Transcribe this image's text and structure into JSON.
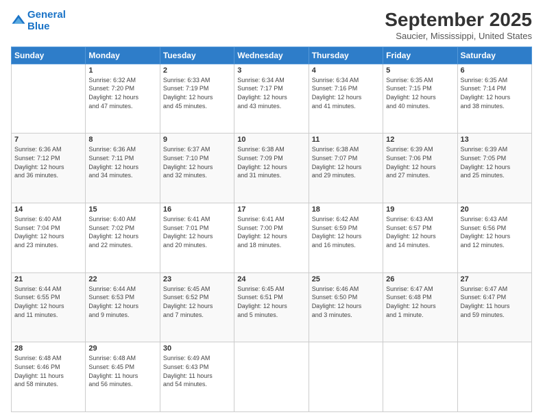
{
  "logo": {
    "line1": "General",
    "line2": "Blue"
  },
  "header": {
    "title": "September 2025",
    "subtitle": "Saucier, Mississippi, United States"
  },
  "weekdays": [
    "Sunday",
    "Monday",
    "Tuesday",
    "Wednesday",
    "Thursday",
    "Friday",
    "Saturday"
  ],
  "weeks": [
    [
      {
        "day": "",
        "info": ""
      },
      {
        "day": "1",
        "info": "Sunrise: 6:32 AM\nSunset: 7:20 PM\nDaylight: 12 hours\nand 47 minutes."
      },
      {
        "day": "2",
        "info": "Sunrise: 6:33 AM\nSunset: 7:19 PM\nDaylight: 12 hours\nand 45 minutes."
      },
      {
        "day": "3",
        "info": "Sunrise: 6:34 AM\nSunset: 7:17 PM\nDaylight: 12 hours\nand 43 minutes."
      },
      {
        "day": "4",
        "info": "Sunrise: 6:34 AM\nSunset: 7:16 PM\nDaylight: 12 hours\nand 41 minutes."
      },
      {
        "day": "5",
        "info": "Sunrise: 6:35 AM\nSunset: 7:15 PM\nDaylight: 12 hours\nand 40 minutes."
      },
      {
        "day": "6",
        "info": "Sunrise: 6:35 AM\nSunset: 7:14 PM\nDaylight: 12 hours\nand 38 minutes."
      }
    ],
    [
      {
        "day": "7",
        "info": "Sunrise: 6:36 AM\nSunset: 7:12 PM\nDaylight: 12 hours\nand 36 minutes."
      },
      {
        "day": "8",
        "info": "Sunrise: 6:36 AM\nSunset: 7:11 PM\nDaylight: 12 hours\nand 34 minutes."
      },
      {
        "day": "9",
        "info": "Sunrise: 6:37 AM\nSunset: 7:10 PM\nDaylight: 12 hours\nand 32 minutes."
      },
      {
        "day": "10",
        "info": "Sunrise: 6:38 AM\nSunset: 7:09 PM\nDaylight: 12 hours\nand 31 minutes."
      },
      {
        "day": "11",
        "info": "Sunrise: 6:38 AM\nSunset: 7:07 PM\nDaylight: 12 hours\nand 29 minutes."
      },
      {
        "day": "12",
        "info": "Sunrise: 6:39 AM\nSunset: 7:06 PM\nDaylight: 12 hours\nand 27 minutes."
      },
      {
        "day": "13",
        "info": "Sunrise: 6:39 AM\nSunset: 7:05 PM\nDaylight: 12 hours\nand 25 minutes."
      }
    ],
    [
      {
        "day": "14",
        "info": "Sunrise: 6:40 AM\nSunset: 7:04 PM\nDaylight: 12 hours\nand 23 minutes."
      },
      {
        "day": "15",
        "info": "Sunrise: 6:40 AM\nSunset: 7:02 PM\nDaylight: 12 hours\nand 22 minutes."
      },
      {
        "day": "16",
        "info": "Sunrise: 6:41 AM\nSunset: 7:01 PM\nDaylight: 12 hours\nand 20 minutes."
      },
      {
        "day": "17",
        "info": "Sunrise: 6:41 AM\nSunset: 7:00 PM\nDaylight: 12 hours\nand 18 minutes."
      },
      {
        "day": "18",
        "info": "Sunrise: 6:42 AM\nSunset: 6:59 PM\nDaylight: 12 hours\nand 16 minutes."
      },
      {
        "day": "19",
        "info": "Sunrise: 6:43 AM\nSunset: 6:57 PM\nDaylight: 12 hours\nand 14 minutes."
      },
      {
        "day": "20",
        "info": "Sunrise: 6:43 AM\nSunset: 6:56 PM\nDaylight: 12 hours\nand 12 minutes."
      }
    ],
    [
      {
        "day": "21",
        "info": "Sunrise: 6:44 AM\nSunset: 6:55 PM\nDaylight: 12 hours\nand 11 minutes."
      },
      {
        "day": "22",
        "info": "Sunrise: 6:44 AM\nSunset: 6:53 PM\nDaylight: 12 hours\nand 9 minutes."
      },
      {
        "day": "23",
        "info": "Sunrise: 6:45 AM\nSunset: 6:52 PM\nDaylight: 12 hours\nand 7 minutes."
      },
      {
        "day": "24",
        "info": "Sunrise: 6:45 AM\nSunset: 6:51 PM\nDaylight: 12 hours\nand 5 minutes."
      },
      {
        "day": "25",
        "info": "Sunrise: 6:46 AM\nSunset: 6:50 PM\nDaylight: 12 hours\nand 3 minutes."
      },
      {
        "day": "26",
        "info": "Sunrise: 6:47 AM\nSunset: 6:48 PM\nDaylight: 12 hours\nand 1 minute."
      },
      {
        "day": "27",
        "info": "Sunrise: 6:47 AM\nSunset: 6:47 PM\nDaylight: 11 hours\nand 59 minutes."
      }
    ],
    [
      {
        "day": "28",
        "info": "Sunrise: 6:48 AM\nSunset: 6:46 PM\nDaylight: 11 hours\nand 58 minutes."
      },
      {
        "day": "29",
        "info": "Sunrise: 6:48 AM\nSunset: 6:45 PM\nDaylight: 11 hours\nand 56 minutes."
      },
      {
        "day": "30",
        "info": "Sunrise: 6:49 AM\nSunset: 6:43 PM\nDaylight: 11 hours\nand 54 minutes."
      },
      {
        "day": "",
        "info": ""
      },
      {
        "day": "",
        "info": ""
      },
      {
        "day": "",
        "info": ""
      },
      {
        "day": "",
        "info": ""
      }
    ]
  ]
}
